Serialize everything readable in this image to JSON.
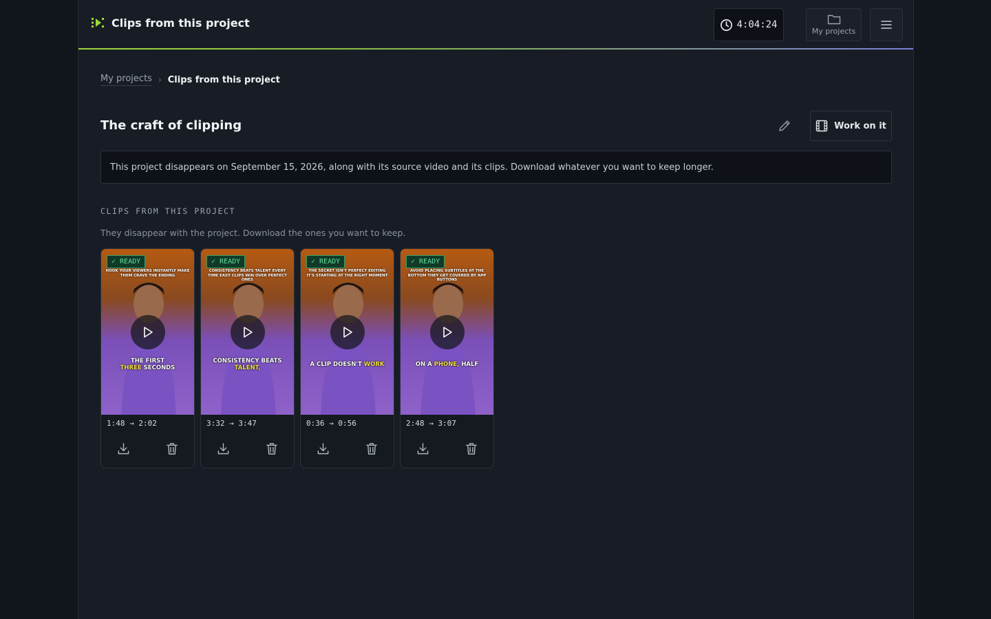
{
  "header": {
    "title": "Clips from this project",
    "timer": "4:04:24",
    "my_projects_label": "My projects",
    "accent": "#9ed83a"
  },
  "breadcrumb": {
    "parent": "My projects",
    "current": "Clips from this project"
  },
  "project": {
    "title": "The craft of clipping",
    "work_button": "Work on it",
    "notice": "This project disappears on September 15, 2026, along with its source video and its clips. Download whatever you want to keep longer."
  },
  "section": {
    "label": "CLIPS FROM THIS PROJECT",
    "subtitle": "They disappear with the project. Download the ones you want to keep."
  },
  "clips": [
    {
      "status": "✓ READY",
      "caption_top": "Hook your viewers instantly make them crave the ending",
      "caption_a": "The first",
      "caption_hl": "three",
      "caption_b": "seconds",
      "range": "1:48 → 2:02"
    },
    {
      "status": "✓ READY",
      "caption_top": "Consistency beats talent every time easy clips win over perfect ones",
      "caption_a": "Consistency beats",
      "caption_hl": "talent,",
      "caption_b": "",
      "range": "3:32 → 3:47"
    },
    {
      "status": "✓ READY",
      "caption_top": "The secret isn't perfect editing it's starting at the right moment",
      "caption_a": "A clip doesn't",
      "caption_hl": "work",
      "caption_b": "",
      "range": "0:36 → 0:56"
    },
    {
      "status": "✓ READY",
      "caption_top": "Avoid placing subtitles at the bottom they get covered by app buttons",
      "caption_a": "On a",
      "caption_hl": "phone,",
      "caption_b": "half",
      "range": "2:48 → 3:07"
    }
  ]
}
